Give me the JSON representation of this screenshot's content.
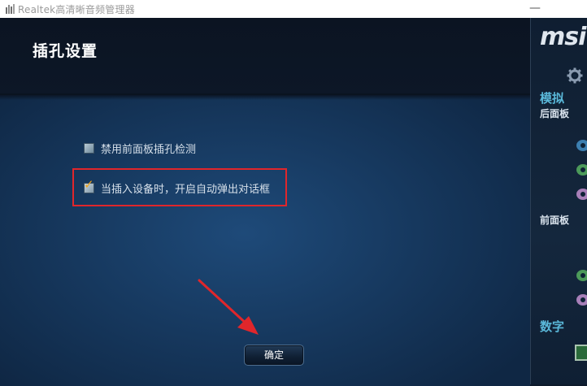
{
  "window": {
    "title": "Realtek高清晰音频管理器",
    "minimize_glyph": "—"
  },
  "header": {
    "page_title": "插孔设置"
  },
  "options": [
    {
      "label": "禁用前面板插孔检测",
      "checked": false
    },
    {
      "label": "当插入设备时，开启自动弹出对话框",
      "checked": true
    }
  ],
  "buttons": {
    "ok_label": "确定"
  },
  "side_panel": {
    "logo_text": "msi",
    "analog_label": "模拟",
    "rear_panel_label": "后面板",
    "front_panel_label": "前面板",
    "digital_label": "数字",
    "rear_jacks": [
      "blue-jack-icon",
      "green-jack-icon",
      "pink-jack-icon"
    ],
    "front_jacks": [
      "green-jack-icon",
      "pink-jack-icon"
    ]
  },
  "colors": {
    "accent_label": "#5ab8d9",
    "highlight_red": "#e0262b",
    "arrow_red": "#e0262b",
    "check_tick": "#f0a21a"
  }
}
